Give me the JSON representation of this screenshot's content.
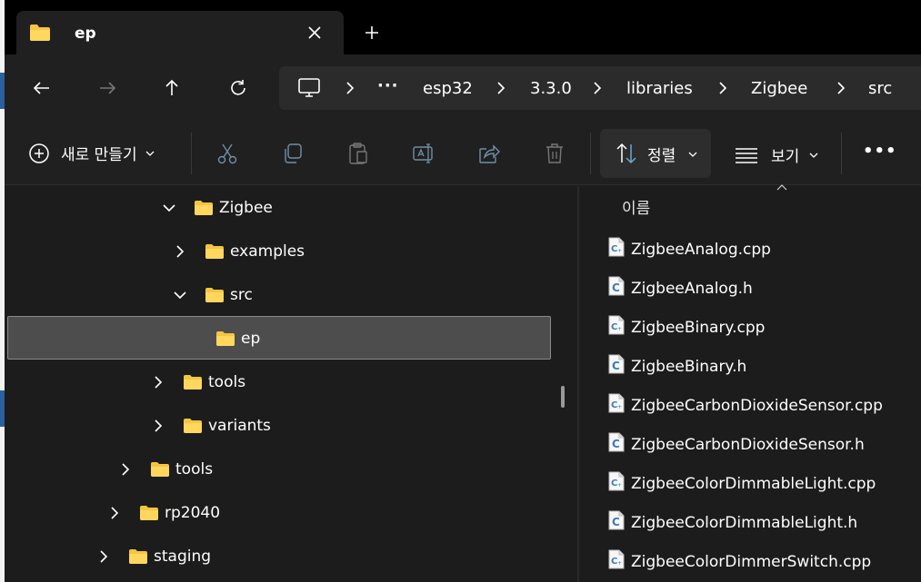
{
  "tab": {
    "title": "ep"
  },
  "breadcrumb": {
    "more": "···",
    "items": [
      "esp32",
      "3.3.0",
      "libraries",
      "Zigbee",
      "src"
    ]
  },
  "toolbar": {
    "new_label": "새로 만들기",
    "sort_label": "정렬",
    "view_label": "보기",
    "more_label": "•••"
  },
  "tree": {
    "items": [
      {
        "label": "Zigbee",
        "expanded": true
      },
      {
        "label": "examples",
        "expanded": false
      },
      {
        "label": "src",
        "expanded": true
      },
      {
        "label": "ep",
        "selected": true
      },
      {
        "label": "tools",
        "expanded": false
      },
      {
        "label": "variants",
        "expanded": false
      },
      {
        "label": "tools",
        "expanded": false
      },
      {
        "label": "rp2040",
        "expanded": false
      },
      {
        "label": "staging",
        "expanded": false
      }
    ]
  },
  "files": {
    "column_header": "이름",
    "items": [
      {
        "name": "ZigbeeAnalog.cpp",
        "type": "cpp"
      },
      {
        "name": "ZigbeeAnalog.h",
        "type": "h"
      },
      {
        "name": "ZigbeeBinary.cpp",
        "type": "cpp"
      },
      {
        "name": "ZigbeeBinary.h",
        "type": "h"
      },
      {
        "name": "ZigbeeCarbonDioxideSensor.cpp",
        "type": "cpp"
      },
      {
        "name": "ZigbeeCarbonDioxideSensor.h",
        "type": "h"
      },
      {
        "name": "ZigbeeColorDimmableLight.cpp",
        "type": "cpp"
      },
      {
        "name": "ZigbeeColorDimmableLight.h",
        "type": "h"
      },
      {
        "name": "ZigbeeColorDimmerSwitch.cpp",
        "type": "cpp"
      }
    ]
  },
  "colors": {
    "folder": "#f4c542",
    "file_icon": "#6aa6d8",
    "background": "#1c1c1c",
    "selected": "#4d4d4d"
  }
}
